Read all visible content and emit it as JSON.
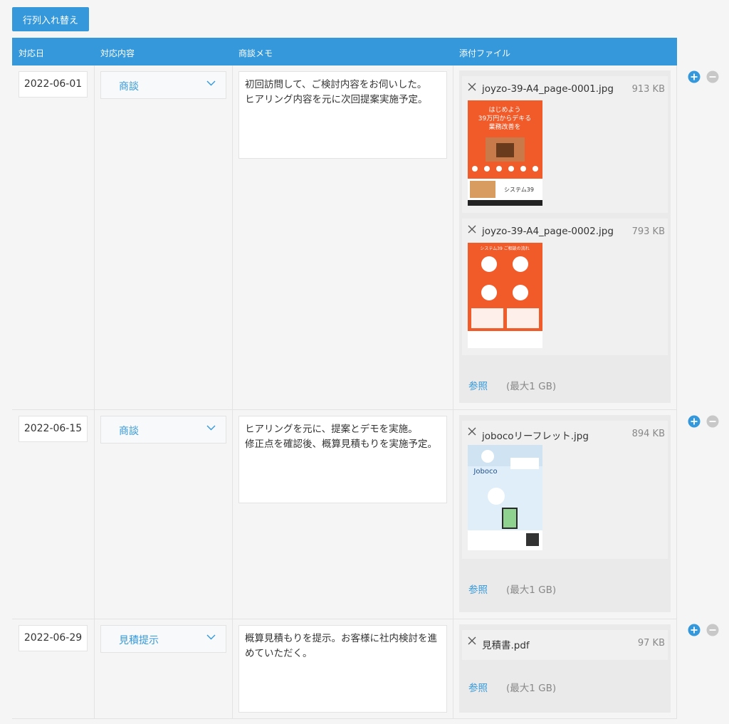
{
  "toolbar": {
    "swap_label": "行列入れ替え"
  },
  "table": {
    "headers": [
      "対応日",
      "対応内容",
      "商談メモ",
      "添付ファイル"
    ],
    "rows": [
      {
        "date": "2022-06-01",
        "type": "商談",
        "memo": "初回訪問して、ご検討内容をお伺いした。\nヒアリング内容を元に次回提案実施予定。",
        "files": [
          {
            "name": "joyzo-39-A4_page-0001.jpg",
            "size": "913 KB",
            "thumb_text": "はじめよう\n39万円からデキる\n業務改善を",
            "thumb_logo": "システム39"
          },
          {
            "name": "joyzo-39-A4_page-0002.jpg",
            "size": "793 KB",
            "thumb_text": "システム39 ご相談の流れ"
          }
        ]
      },
      {
        "date": "2022-06-15",
        "type": "商談",
        "memo": "ヒアリングを元に、提案とデモを実施。\n修正点を確認後、概算見積もりを実施予定。",
        "files": [
          {
            "name": "jobocoリーフレット.jpg",
            "size": "894 KB",
            "thumb_text": "Joboco"
          }
        ]
      },
      {
        "date": "2022-06-29",
        "type": "見積提示",
        "memo": "概算見積もりを提示。お客様に社内検討を進めていただく。",
        "files": [
          {
            "name": "見積書.pdf",
            "size": "97 KB"
          }
        ]
      }
    ],
    "browse_label": "参照",
    "max_size_label": "(最大1 GB)"
  },
  "icons": {
    "add": "plus-circle-icon",
    "remove": "minus-circle-icon",
    "delete_file": "close-icon",
    "dropdown": "chevron-down-icon"
  },
  "colors": {
    "accent": "#3498db",
    "add": "#3498db",
    "remove": "#c8c8c8",
    "thumb_orange": "#f15a29"
  }
}
